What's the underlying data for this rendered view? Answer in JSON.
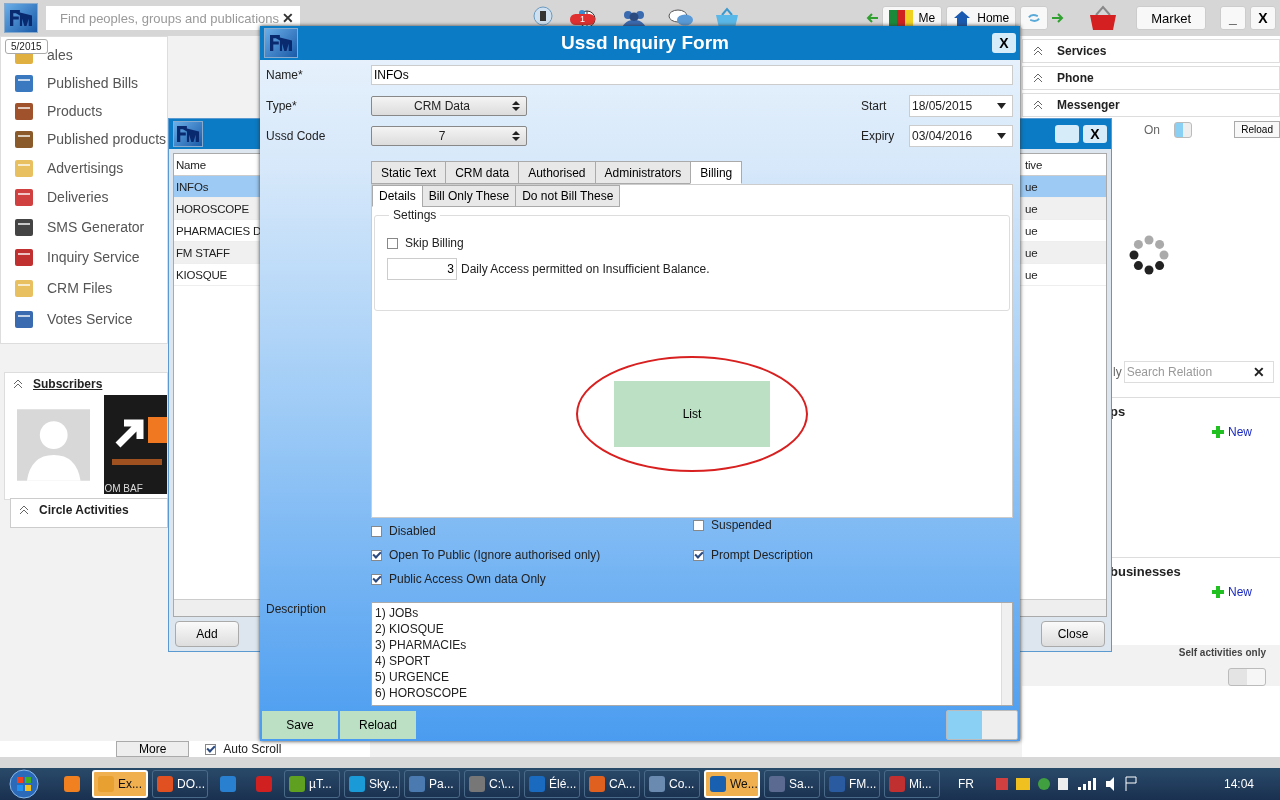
{
  "topbar": {
    "search": {
      "placeholder": "Find peoples, groups and publications"
    },
    "clear": "✕",
    "badge": "1",
    "nav": [
      {
        "label": "Me",
        "kind": "flag"
      },
      {
        "label": "Home",
        "kind": "home"
      }
    ],
    "market": "Market",
    "window_buttons": [
      "_",
      "X"
    ]
  },
  "sidebar": {
    "tooltip": "5/2015",
    "items": [
      {
        "label": "ales"
      },
      {
        "label": "Published Bills"
      },
      {
        "label": "Products"
      },
      {
        "label": "Published products"
      },
      {
        "label": "Advertisings"
      },
      {
        "label": "Deliveries"
      },
      {
        "label": "SMS Generator"
      },
      {
        "label": "Inquiry Service"
      },
      {
        "label": "CRM Files"
      },
      {
        "label": "Votes Service"
      }
    ]
  },
  "subscribers": {
    "title": "Subscribers",
    "members": [
      {
        "kind": "avatar"
      },
      {
        "kind": "picture",
        "caption": "OM BAF"
      }
    ]
  },
  "circle_activities": {
    "title": "Circle Activities",
    "more": "More",
    "auto_scroll": {
      "label": "Auto Scroll",
      "checked": true
    }
  },
  "right_panel": {
    "sections": [
      "Services",
      "Phone",
      "Messenger"
    ],
    "messenger": {
      "label": "On",
      "on": true,
      "reload": "Reload"
    },
    "search_prefix": "ly",
    "search": {
      "placeholder": "Search Relation"
    },
    "clear": "✕",
    "groups": [
      {
        "title": "ps",
        "new": "New"
      },
      {
        "title": "businesses",
        "new": "New"
      }
    ],
    "self_activities": {
      "label": "Self activities only",
      "on": false
    }
  },
  "list_window": {
    "columns": [
      "Name",
      "tive"
    ],
    "rows": [
      {
        "name": "INFOs",
        "column_2": "ue",
        "selected": true
      },
      {
        "name": "HOROSCOPE",
        "column_2": "ue",
        "selected": false
      },
      {
        "name": "PHARMACIES D",
        "column_2": "ue",
        "selected": false
      },
      {
        "name": "FM STAFF",
        "column_2": "ue",
        "selected": false
      },
      {
        "name": "KIOSQUE",
        "column_2": "ue",
        "selected": false
      }
    ],
    "add": "Add",
    "close": "Close",
    "close_x": "X"
  },
  "dialog": {
    "title": "Ussd Inquiry Form",
    "close": "X",
    "name": {
      "label": "Name*",
      "value": "INFOs"
    },
    "type": {
      "label": "Type*",
      "value": "CRM Data"
    },
    "ussd_code": {
      "label": "Ussd Code",
      "value": "7"
    },
    "start": {
      "label": "Start",
      "value": "18/05/2015"
    },
    "expiry": {
      "label": "Expiry",
      "value": "03/04/2016"
    },
    "tabs": [
      {
        "label": "Static Text",
        "selected": false
      },
      {
        "label": "CRM data",
        "selected": false
      },
      {
        "label": "Authorised",
        "selected": false
      },
      {
        "label": "Administrators",
        "selected": false
      },
      {
        "label": "Billing",
        "selected": true
      }
    ],
    "subtabs": [
      {
        "label": "Details",
        "selected": true
      },
      {
        "label": "Bill Only These",
        "selected": false
      },
      {
        "label": "Do not Bill These",
        "selected": false
      }
    ],
    "settings": {
      "title": "Settings",
      "skip_billing": {
        "label": "Skip Billing",
        "checked": false
      },
      "daily_access": {
        "value": "3",
        "label": "Daily Access permitted on Insufficient Balance."
      }
    },
    "list_button": "List",
    "options": [
      {
        "label": "Disabled",
        "checked": false
      },
      {
        "label": "Suspended",
        "checked": false
      },
      {
        "label": "Open To Public (Ignore authorised only)",
        "checked": true
      },
      {
        "label": "Prompt Description",
        "checked": true
      },
      {
        "label": "Public  Access Own data Only",
        "checked": true
      }
    ],
    "description": {
      "label": "Description",
      "lines": [
        "1) JOBs",
        "2) KIOSQUE",
        "3) PHARMACIEs",
        "4) SPORT",
        "5) URGENCE",
        "6) HOROSCOPE"
      ]
    },
    "save": "Save",
    "reload": "Reload",
    "toggle_on": true
  },
  "taskbar": {
    "items": [
      {
        "selected": false
      },
      {
        "label": "Ex...",
        "selected": true
      },
      {
        "label": "DO...",
        "selected": false
      },
      {
        "selected": false
      },
      {
        "selected": false
      },
      {
        "label": "µT...",
        "selected": false
      },
      {
        "label": "Sky...",
        "selected": false
      },
      {
        "label": "Pa...",
        "selected": false
      },
      {
        "label": "C:\\...",
        "selected": false
      },
      {
        "label": "Élé...",
        "selected": false
      },
      {
        "label": "CA...",
        "selected": false
      },
      {
        "label": "Co...",
        "selected": false
      },
      {
        "label": "We...",
        "selected": true
      },
      {
        "label": "Sa...",
        "selected": false
      },
      {
        "label": "FM...",
        "selected": false
      },
      {
        "label": "Mi...",
        "selected": false
      }
    ],
    "language": "FR",
    "time": "14:04"
  }
}
